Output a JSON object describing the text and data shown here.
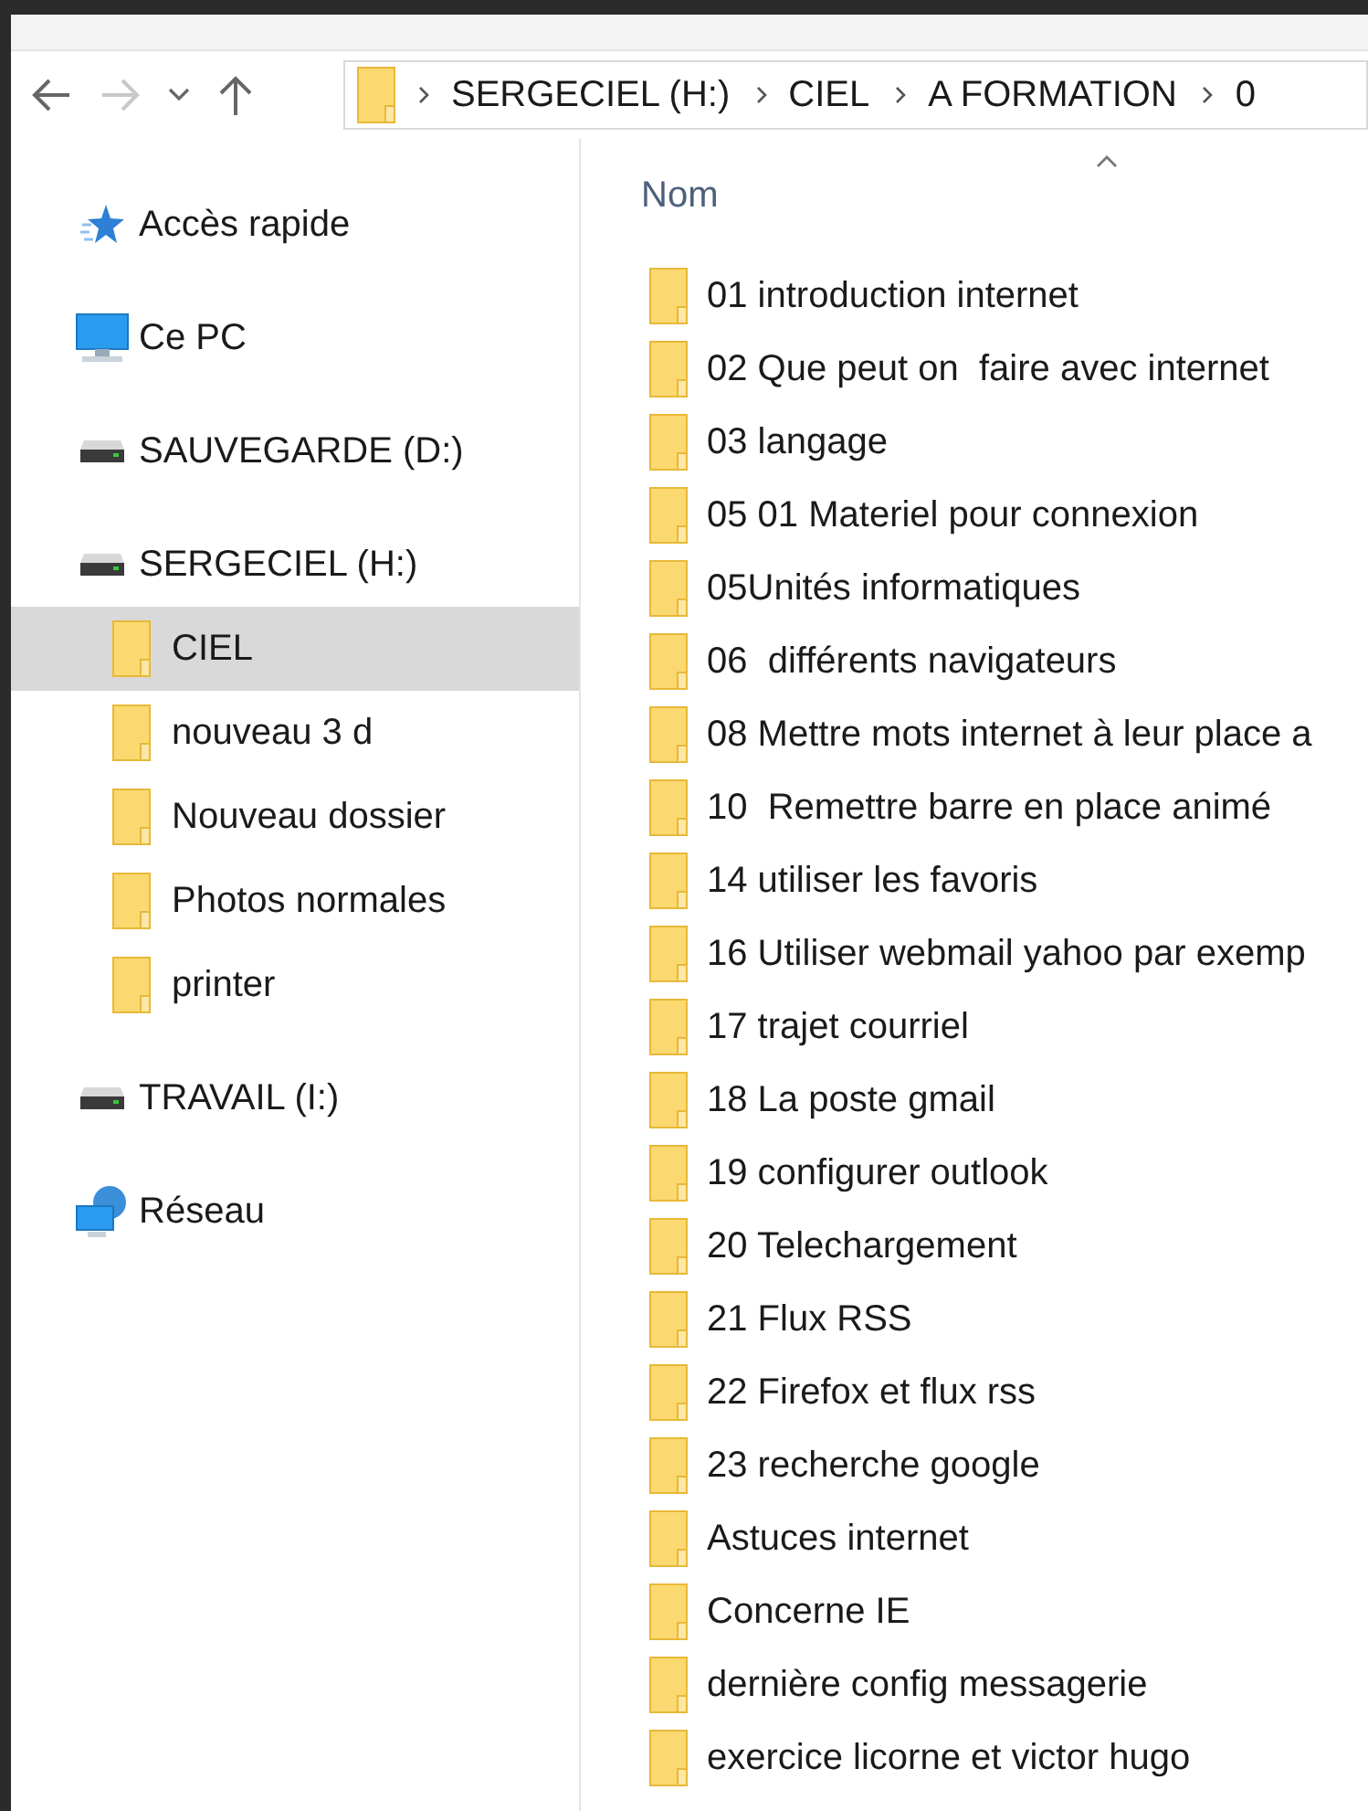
{
  "nav_buttons": [
    {
      "kind": "back",
      "disabled": false
    },
    {
      "kind": "forward",
      "disabled": true
    },
    {
      "kind": "recent",
      "disabled": false
    },
    {
      "kind": "up",
      "disabled": false
    }
  ],
  "breadcrumb": [
    "SERGECIEL (H:)",
    "CIEL",
    "A FORMATION",
    "0"
  ],
  "sidebar": {
    "items": [
      {
        "kind": "quick",
        "label": "Accès rapide"
      },
      {
        "kind": "pc",
        "label": "Ce PC"
      },
      {
        "kind": "drive",
        "label": "SAUVEGARDE (D:)"
      },
      {
        "kind": "drive",
        "label": "SERGECIEL (H:)",
        "children": [
          {
            "label": "CIEL",
            "selected": true
          },
          {
            "label": "nouveau 3 d",
            "selected": false
          },
          {
            "label": "Nouveau dossier",
            "selected": false
          },
          {
            "label": "Photos normales",
            "selected": false
          },
          {
            "label": "printer",
            "selected": false
          }
        ]
      },
      {
        "kind": "drive",
        "label": "TRAVAIL (I:)"
      },
      {
        "kind": "network",
        "label": "Réseau"
      }
    ]
  },
  "list": {
    "column": "Nom",
    "items": [
      "01 introduction internet",
      "02 Que peut on  faire avec internet",
      "03 langage",
      "05 01 Materiel pour connexion",
      "05Unités informatiques",
      "06  différents navigateurs",
      "08 Mettre mots internet à leur place a",
      "10  Remettre barre en place animé",
      "14 utiliser les favoris",
      "16 Utiliser webmail yahoo par exemp",
      "17 trajet courriel",
      "18 La poste gmail",
      "19 configurer outlook",
      "20 Telechargement",
      "21 Flux RSS",
      "22 Firefox et flux rss",
      "23 recherche google",
      "Astuces internet",
      "Concerne IE",
      "dernière config messagerie",
      "exercice licorne et victor hugo"
    ]
  }
}
